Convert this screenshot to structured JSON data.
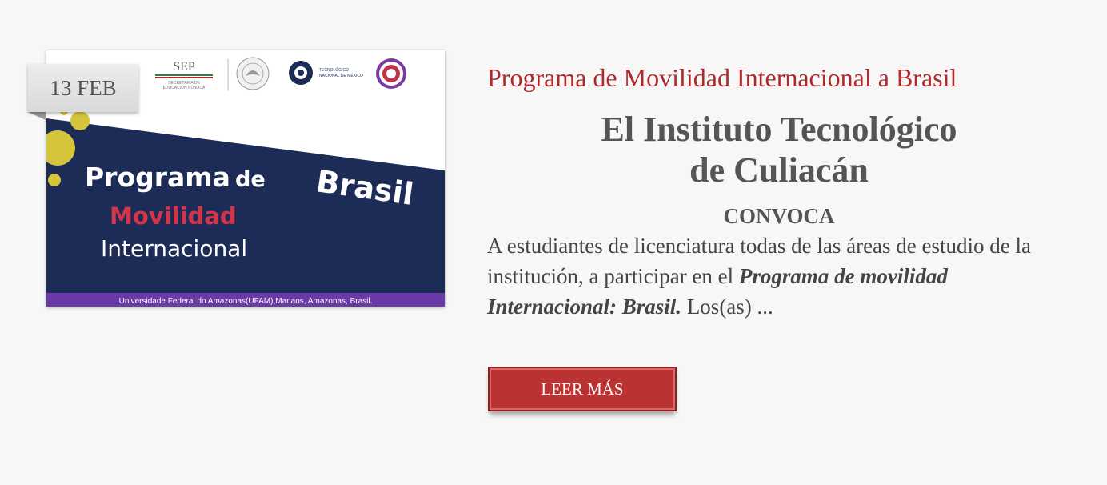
{
  "date_badge": {
    "text": "13 FEB"
  },
  "image": {
    "sep_label": "SEP",
    "sep_sub1": "SECRETARÍA DE",
    "sep_sub2": "EDUCACIÓN PÚBLICA",
    "tec_line1": "TECNOLÓGICO",
    "tec_line2": "NACIONAL DE MÉXICO",
    "line1": "Programa",
    "line1b": "de",
    "line2": "Movilidad",
    "line3": "Internacional",
    "country": "Brasil",
    "footer": "Universidade Federal do Amazonas(UFAM),Manaos, Amazonas, Brasil.",
    "colors": {
      "navy": "#1c2c57",
      "red": "#d2354a",
      "purple": "#6a3aa8",
      "yellow": "#d4c53a"
    }
  },
  "post": {
    "title": "Programa de Movilidad Internacional a Brasil",
    "headline_line1": "El Instituto Tecnológico",
    "headline_line2": "de Culiacán",
    "convoca": "CONVOCA",
    "excerpt_start": "A estudiantes de licenciatura todas de las áreas de estudio de la institución, a participar en el ",
    "excerpt_bold": "Programa de movilidad Internacional: Brasil.",
    "excerpt_end": " Los(as) ...",
    "read_more": "LEER MÁS"
  }
}
